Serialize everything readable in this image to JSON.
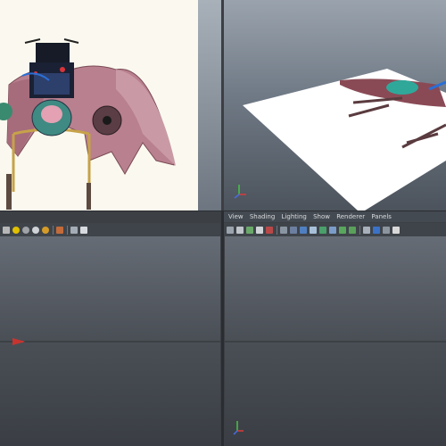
{
  "viewport_menu": {
    "items": [
      "View",
      "Shading",
      "Lighting",
      "Show",
      "Renderer",
      "Panels"
    ]
  },
  "colors": {
    "viewport_bg": "#4a4f56",
    "ground_plane": "#ffffff",
    "axis_x": "#d83a3a",
    "axis_y": "#47c447",
    "axis_z": "#4a6be0"
  },
  "toolbar_icons": {
    "left": [
      "wireframe-icon",
      "smooth-shade-icon",
      "light-sphere-icon",
      "flat-sphere-icon",
      "textured-sphere-icon",
      "select-camera-icon",
      "cube-icon",
      "share-icon"
    ],
    "right": [
      "camera-icon",
      "bookmark-icon",
      "image-plane-icon",
      "grid-icon",
      "film-gate-icon",
      "resolution-gate-icon",
      "safe-frame-icon",
      "wireframe-icon",
      "shaded-icon",
      "textured-icon",
      "light-icon",
      "shadow-icon",
      "text-icon",
      "cube-icon",
      "isolate-icon",
      "xray-icon",
      "default-light-icon"
    ]
  }
}
